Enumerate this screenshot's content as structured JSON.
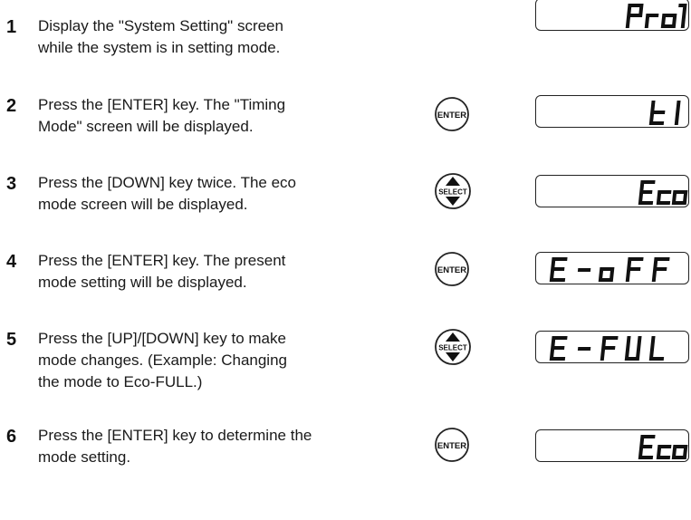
{
  "steps": [
    {
      "number": "1",
      "line1": "Display the \"System Setting\" screen",
      "line2": "while the system is in setting mode.",
      "line3": "",
      "key": "none",
      "display": "Pro7"
    },
    {
      "number": "2",
      "line1": "Press the [ENTER] key. The \"Timing",
      "line2": "Mode\" screen will be displayed.",
      "line3": "",
      "key": "ENTER",
      "display": "t1"
    },
    {
      "number": "3",
      "line1": "Press the [DOWN] key twice. The eco",
      "line2": "mode screen will be displayed.",
      "line3": "",
      "key": "SELECT",
      "display": "Eco"
    },
    {
      "number": "4",
      "line1": "Press the [ENTER] key. The present",
      "line2": "mode setting will be displayed.",
      "line3": "",
      "key": "ENTER",
      "display": "E-oFF"
    },
    {
      "number": "5",
      "line1": "Press the [UP]/[DOWN] key to make",
      "line2": "mode changes. (Example: Changing",
      "line3": "the mode to Eco-FULL.)",
      "key": "SELECT",
      "display": "E-FUL"
    },
    {
      "number": "6",
      "line1": "Press the [ENTER] key to determine the",
      "line2": "mode setting.",
      "line3": "",
      "key": "ENTER",
      "display": "Eco"
    }
  ],
  "keys": {
    "enter_label": "ENTER",
    "select_label": "SELECT"
  }
}
